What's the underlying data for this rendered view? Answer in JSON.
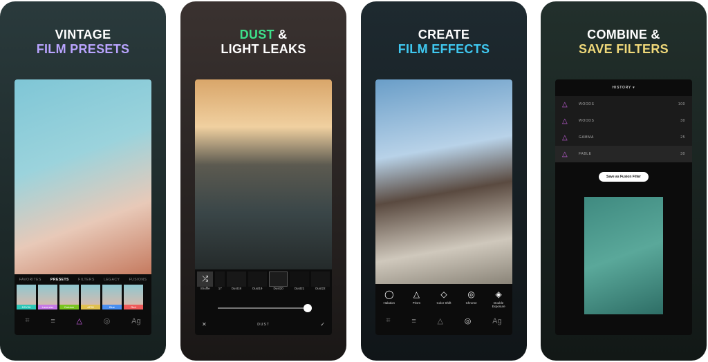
{
  "panels": [
    {
      "line1": "VINTAGE",
      "line2": "FILM PRESETS",
      "accent": "#b9a4ff",
      "tabs": [
        "FAVORITES",
        "PRESETS",
        "FILTERS",
        "LEGACY",
        "FUSIONS"
      ],
      "active_tab": "PRESETS",
      "presets": [
        {
          "label": "DSY06",
          "color": "#2fc7b8"
        },
        {
          "label": "Lavender",
          "color": "#c678e6"
        },
        {
          "label": "Calcium",
          "color": "#7ac420"
        },
        {
          "label": "AF20",
          "color": "#e0c050"
        },
        {
          "label": "Blue",
          "color": "#4a8ef0"
        },
        {
          "label": "Red",
          "color": "#ee5a5a"
        }
      ]
    },
    {
      "line1": "DUST",
      "line1b": " &",
      "line2": "LIGHT LEAKS",
      "accent": "#3de08a",
      "dust_items": [
        "Shuffle",
        "17",
        "Dust18",
        "Dust19",
        "Dust20",
        "Dust21",
        "Dust22"
      ],
      "slider_value": 0.9,
      "title": "DUST"
    },
    {
      "line1": "CREATE",
      "line2": "FILM EFFECTS",
      "accent": "#3fc8f0",
      "effects": [
        {
          "label": "Halation",
          "icon": "ring-icon"
        },
        {
          "label": "Prism",
          "icon": "prism-icon"
        },
        {
          "label": "Color Shift",
          "icon": "diamond-icon"
        },
        {
          "label": "Chrome",
          "icon": "chrome-icon"
        },
        {
          "label": "Double Exposure",
          "icon": "layers-icon"
        }
      ]
    },
    {
      "line1": "COMBINE &",
      "line2": "SAVE FILTERS",
      "accent": "#f0d97a",
      "history_title": "HISTORY ▾",
      "history": [
        {
          "name": "WOODS",
          "value": "100"
        },
        {
          "name": "WOODS",
          "value": "30"
        },
        {
          "name": "GAMMA",
          "value": "25"
        },
        {
          "name": "FABLE",
          "value": "30"
        }
      ],
      "save_button": "Save as Fusion Filter"
    }
  ]
}
